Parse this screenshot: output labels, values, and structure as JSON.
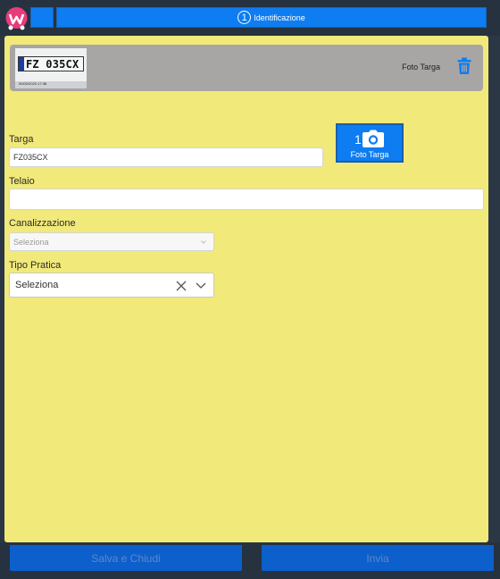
{
  "header": {
    "step_number": "1",
    "step_label": "Identificazione"
  },
  "photo_strip": {
    "thumbnail": {
      "plate_text": "FZ 035CX",
      "date_text": "00/00/2023 17:38"
    },
    "label": "Foto Targa",
    "delete_icon": "trash-icon"
  },
  "form": {
    "targa": {
      "label": "Targa",
      "value": "FZ035CX"
    },
    "telaio": {
      "label": "Telaio",
      "value": ""
    },
    "canalizzazione": {
      "label": "Canalizzazione",
      "placeholder": "Seleziona"
    },
    "tipo_pratica": {
      "label": "Tipo Pratica",
      "selected": "Seleziona"
    }
  },
  "foto_button": {
    "count": "1",
    "label": "Foto Targa",
    "icon": "camera-icon"
  },
  "footer": {
    "save_label": "Salva e Chiudi",
    "send_label": "Invia"
  },
  "colors": {
    "accent": "#0d7df1",
    "panel": "#f1e97a",
    "dark": "#26323f"
  }
}
